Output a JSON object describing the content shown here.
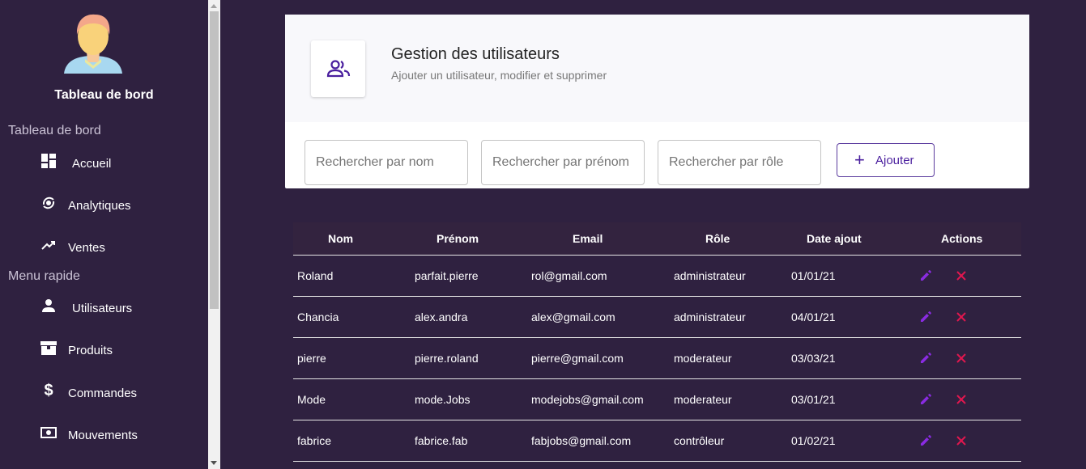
{
  "sidebar": {
    "brand": "Tableau de bord",
    "sections": [
      {
        "label": "Tableau de bord",
        "items": [
          {
            "label": "Accueil",
            "icon": "dashboard-icon"
          },
          {
            "label": "Analytiques",
            "icon": "analytics-icon"
          },
          {
            "label": "Ventes",
            "icon": "trending-up-icon"
          }
        ]
      },
      {
        "label": "Menu rapide",
        "items": [
          {
            "label": "Utilisateurs",
            "icon": "person-icon"
          },
          {
            "label": "Produits",
            "icon": "storefront-icon"
          },
          {
            "label": "Commandes",
            "icon": "dollar-icon"
          },
          {
            "label": "Mouvements",
            "icon": "money-icon"
          }
        ]
      }
    ]
  },
  "header": {
    "title": "Gestion des utilisateurs",
    "subtitle": "Ajouter un utilisateur, modifier et supprimer",
    "icon": "group-icon"
  },
  "search": {
    "nom_placeholder": "Rechercher par nom",
    "prenom_placeholder": "Rechercher par prénom",
    "role_placeholder": "Rechercher par rôle"
  },
  "add_button_label": "Ajouter",
  "table": {
    "headers": [
      "Nom",
      "Prénom",
      "Email",
      "Rôle",
      "Date ajout",
      "Actions"
    ],
    "rows": [
      [
        "Roland",
        "parfait.pierre",
        "rol@gmail.com",
        "administrateur",
        "01/01/21"
      ],
      [
        "Chancia",
        "alex.andra",
        "alex@gmail.com",
        "administrateur",
        "04/01/21"
      ],
      [
        "pierre",
        "pierre.roland",
        "pierre@gmail.com",
        "moderateur",
        "03/03/21"
      ],
      [
        "Mode",
        "mode.Jobs",
        "modejobs@gmail.com",
        "moderateur",
        "03/01/21"
      ],
      [
        "fabrice",
        "fabrice.fab",
        "fabjobs@gmail.com",
        "contrôleur",
        "01/02/21"
      ]
    ]
  },
  "colors": {
    "background": "#2f2140",
    "accent": "#4a1f9e",
    "edit_icon": "#8a2be2",
    "delete_icon": "#e0174f"
  }
}
